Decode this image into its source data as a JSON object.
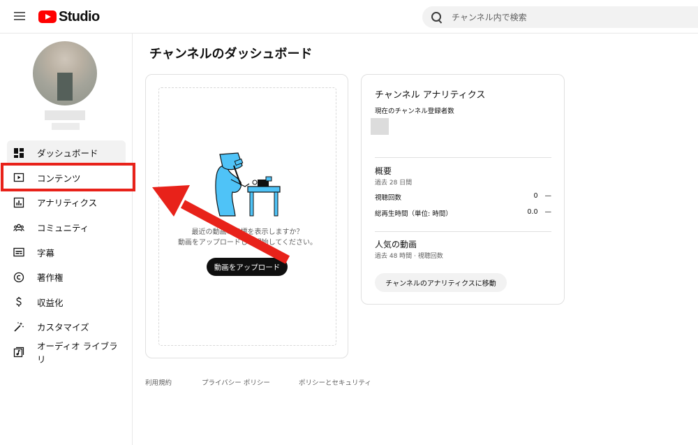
{
  "header": {
    "logo_text": "Studio",
    "search_placeholder": "チャンネル内で検索"
  },
  "sidebar": {
    "items": [
      {
        "label": "ダッシュボード",
        "icon": "dashboard-icon"
      },
      {
        "label": "コンテンツ",
        "icon": "content-icon"
      },
      {
        "label": "アナリティクス",
        "icon": "analytics-icon"
      },
      {
        "label": "コミュニティ",
        "icon": "community-icon"
      },
      {
        "label": "字幕",
        "icon": "subtitles-icon"
      },
      {
        "label": "著作権",
        "icon": "copyright-icon"
      },
      {
        "label": "収益化",
        "icon": "dollar-icon"
      },
      {
        "label": "カスタマイズ",
        "icon": "magic-wand-icon"
      },
      {
        "label": "オーディオ ライブラリ",
        "icon": "audio-library-icon"
      }
    ]
  },
  "main": {
    "title": "チャンネルのダッシュボード",
    "upload_card": {
      "message_line1": "最近の動画の指標を表示しますか？",
      "message_line2": "動画をアップロードして開始してください。",
      "button_label": "動画をアップロード"
    },
    "analytics_card": {
      "title": "チャンネル アナリティクス",
      "subscribers_label": "現在のチャンネル登録者数",
      "summary_title": "概要",
      "summary_period": "過去 28 日間",
      "rows": [
        {
          "label": "視聴回数",
          "value": "0",
          "trend": "—"
        },
        {
          "label": "総再生時間（単位: 時間）",
          "value": "0.0",
          "trend": "—"
        }
      ],
      "top_videos_title": "人気の動画",
      "top_videos_meta": "過去 48 時間 · 視聴回数",
      "button_label": "チャンネルのアナリティクスに移動"
    },
    "footer": {
      "links": [
        "利用規約",
        "プライバシー ポリシー",
        "ポリシーとセキュリティ"
      ]
    }
  },
  "colors": {
    "brand_red": "#ff0000",
    "annotation_red": "#e8221a",
    "button_dark": "#0f0f0f",
    "illustration_blue": "#4fc3f7"
  }
}
